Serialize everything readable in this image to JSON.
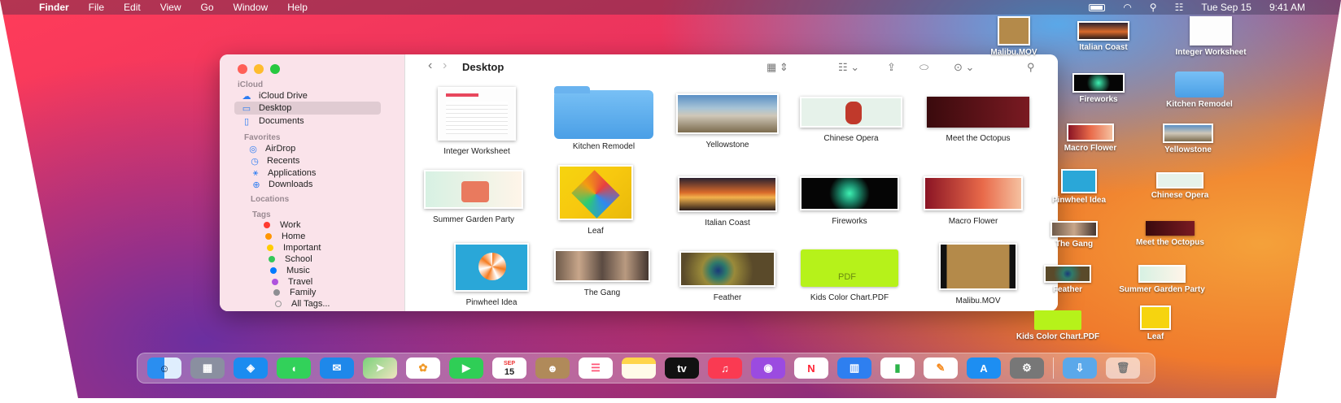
{
  "menubar": {
    "apple": "",
    "app": "Finder",
    "items": [
      "File",
      "Edit",
      "View",
      "Go",
      "Window",
      "Help"
    ],
    "date": "Tue Sep 15",
    "time": "9:41 AM"
  },
  "finder": {
    "title": "Desktop",
    "sidebar": {
      "icloud_header": "iCloud",
      "icloud": [
        {
          "label": "iCloud Drive",
          "icon": "cloud-icon"
        },
        {
          "label": "Desktop",
          "icon": "desktop-icon"
        },
        {
          "label": "Documents",
          "icon": "document-icon"
        }
      ],
      "favorites_header": "Favorites",
      "favorites": [
        {
          "label": "AirDrop",
          "icon": "airdrop-icon"
        },
        {
          "label": "Recents",
          "icon": "clock-icon"
        },
        {
          "label": "Applications",
          "icon": "applications-icon"
        },
        {
          "label": "Downloads",
          "icon": "download-icon"
        }
      ],
      "locations_header": "Locations",
      "tags_header": "Tags",
      "tags": [
        {
          "label": "Work",
          "color": "#ff3b30"
        },
        {
          "label": "Home",
          "color": "#ff9500"
        },
        {
          "label": "Important",
          "color": "#ffcc00"
        },
        {
          "label": "School",
          "color": "#34c759"
        },
        {
          "label": "Music",
          "color": "#007aff"
        },
        {
          "label": "Travel",
          "color": "#af52de"
        },
        {
          "label": "Family",
          "color": "#8e8e93"
        },
        {
          "label": "All Tags...",
          "color": ""
        }
      ]
    },
    "files": [
      {
        "label": "Integer Worksheet"
      },
      {
        "label": "Kitchen Remodel"
      },
      {
        "label": "Yellowstone"
      },
      {
        "label": "Chinese Opera"
      },
      {
        "label": "Meet the Octopus"
      },
      {
        "label": "Summer Garden Party"
      },
      {
        "label": "Leaf"
      },
      {
        "label": "Italian Coast"
      },
      {
        "label": "Fireworks"
      },
      {
        "label": "Macro Flower"
      },
      {
        "label": "Pinwheel Idea"
      },
      {
        "label": "The Gang"
      },
      {
        "label": "Feather"
      },
      {
        "label": "Kids Color Chart.PDF"
      },
      {
        "label": "Malibu.MOV"
      }
    ]
  },
  "desktop_icons": [
    {
      "label": "Malibu.MOV"
    },
    {
      "label": "Italian Coast"
    },
    {
      "label": "Integer Worksheet"
    },
    {
      "label": "Fireworks"
    },
    {
      "label": "Kitchen Remodel"
    },
    {
      "label": "Macro Flower"
    },
    {
      "label": "Yellowstone"
    },
    {
      "label": "Pinwheel Idea"
    },
    {
      "label": "Chinese Opera"
    },
    {
      "label": "The Gang"
    },
    {
      "label": "Meet the Octopus"
    },
    {
      "label": "Feather"
    },
    {
      "label": "Summer Garden Party"
    },
    {
      "label": "Kids Color Chart.PDF"
    },
    {
      "label": "Leaf"
    }
  ],
  "dock": {
    "calendar_month": "SEP",
    "calendar_day": "15",
    "tv_label": "tv",
    "pdf_label": "PDF",
    "apps": [
      "finder-icon",
      "launchpad-icon",
      "safari-icon",
      "messages-icon",
      "mail-icon",
      "maps-icon",
      "photos-icon",
      "facetime-icon",
      "calendar-icon",
      "contacts-icon",
      "reminders-icon",
      "notes-icon",
      "tv-icon",
      "music-icon",
      "podcasts-icon",
      "news-icon",
      "keynote-icon",
      "numbers-icon",
      "pages-icon",
      "app-store-icon",
      "system-preferences-icon",
      "downloads-folder-icon",
      "trash-icon"
    ]
  }
}
